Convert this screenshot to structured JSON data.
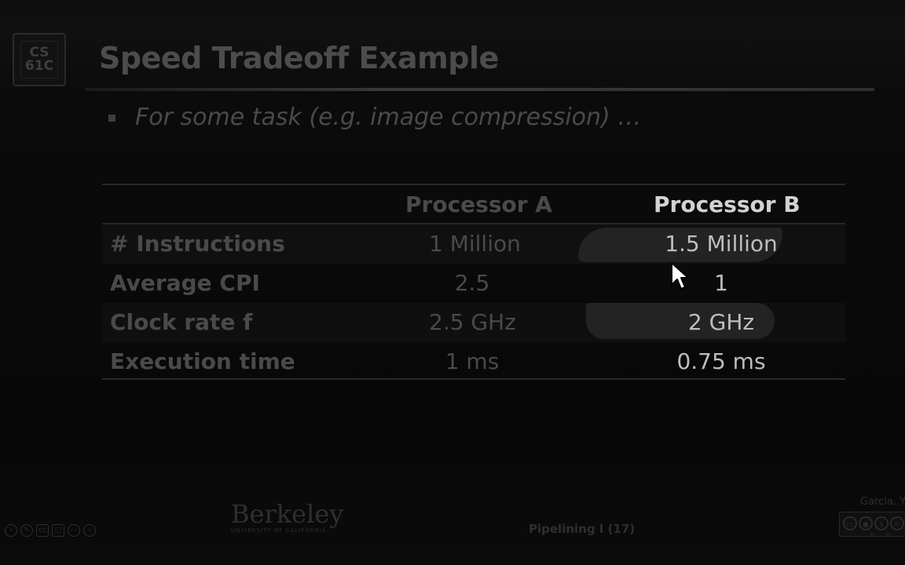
{
  "slide": {
    "logo": {
      "line1": "CS",
      "line2": "61C"
    },
    "title": "Speed Tradeoff Example",
    "bullet": "For some task (e.g. image compression) …"
  },
  "table": {
    "headers": {
      "col_a": "Processor A",
      "col_b": "Processor B"
    },
    "rows": [
      {
        "label": "# Instructions",
        "a": "1 Million",
        "b": "1.5 Million"
      },
      {
        "label": "Average CPI",
        "a": "2.5",
        "b": "1"
      },
      {
        "label": "Clock rate f",
        "a": "2.5 GHz",
        "b": "2 GHz"
      },
      {
        "label": "Execution time",
        "a": "1 ms",
        "b": "0.75 ms"
      }
    ]
  },
  "footer": {
    "berkeley_name": "Berkeley",
    "berkeley_sub": "UNIVERSITY OF CALIFORNIA",
    "center_text": "Pipelining I (17)",
    "author": "Garcia, Yo",
    "cc_labels": [
      "BY",
      "NC"
    ],
    "icons": [
      "back-icon",
      "pen-icon",
      "cc-icon",
      "monitor-icon",
      "more-icon",
      "forward-icon"
    ]
  },
  "colors": {
    "background": "#000000",
    "highlight": "#3a3a3a",
    "emphasis_text": "#d2d2d2"
  }
}
